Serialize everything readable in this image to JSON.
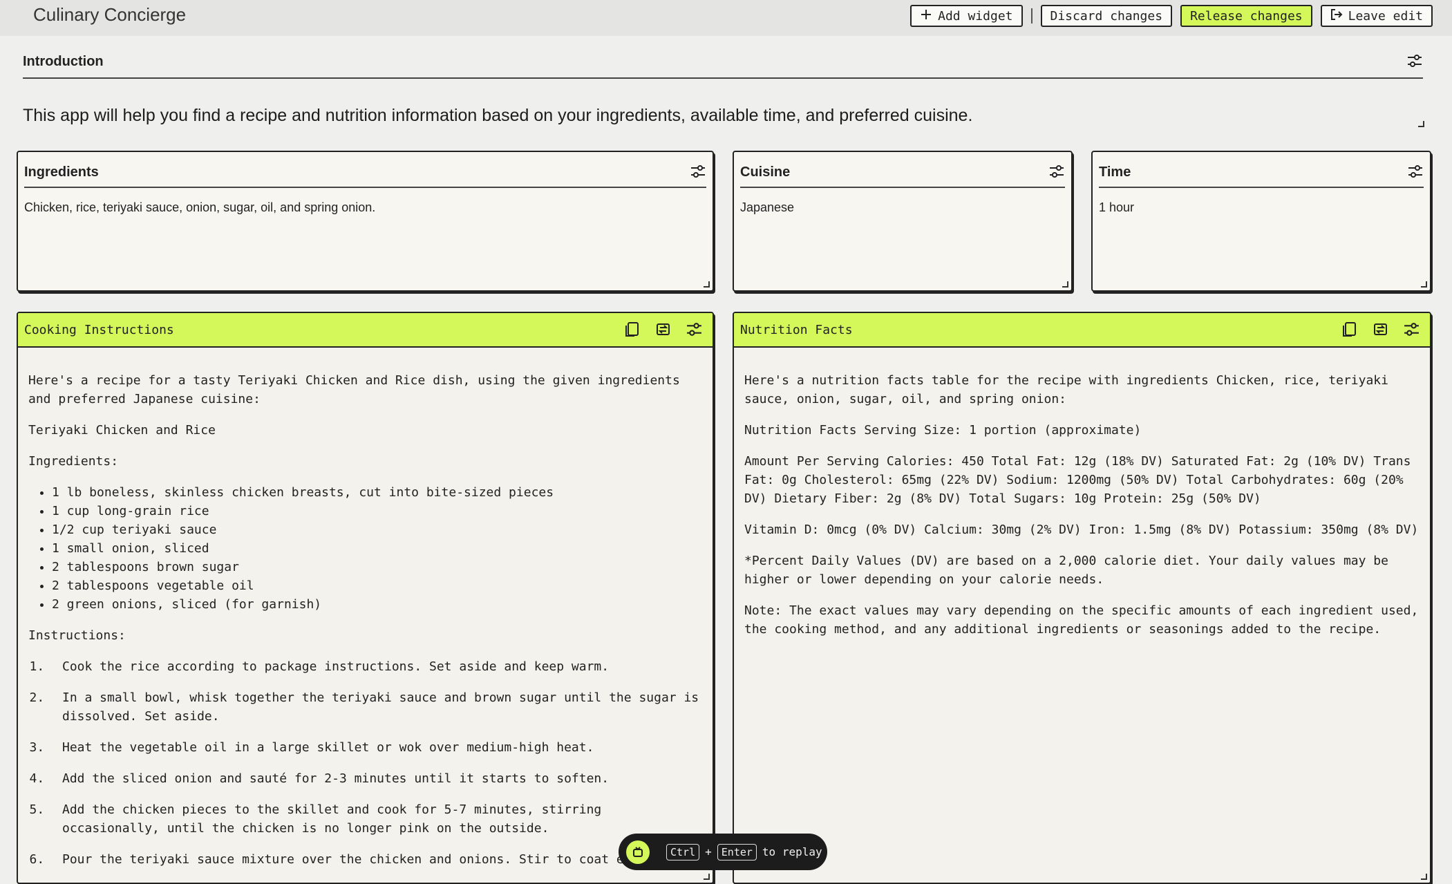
{
  "app": {
    "title": "Culinary Concierge"
  },
  "toolbar": {
    "add_widget": "Add widget",
    "discard": "Discard changes",
    "release": "Release changes",
    "leave": "Leave edit"
  },
  "intro": {
    "label": "Introduction",
    "text": "This app will help you find a recipe and nutrition information based on your ingredients, available time, and preferred cuisine."
  },
  "inputs": {
    "ingredients": {
      "label": "Ingredients",
      "value": "Chicken, rice, teriyaki sauce, onion, sugar, oil, and spring onion."
    },
    "cuisine": {
      "label": "Cuisine",
      "value": "Japanese"
    },
    "time": {
      "label": "Time",
      "value": "1 hour"
    }
  },
  "cooking": {
    "label": "Cooking Instructions",
    "intro": "Here's a recipe for a tasty Teriyaki Chicken and Rice dish, using the given ingredients and preferred Japanese cuisine:",
    "dish": "Teriyaki Chicken and Rice",
    "ingredients_heading": "Ingredients:",
    "ingredients": [
      "1 lb boneless, skinless chicken breasts, cut into bite-sized pieces",
      "1 cup long-grain rice",
      "1/2 cup teriyaki sauce",
      "1 small onion, sliced",
      "2 tablespoons brown sugar",
      "2 tablespoons vegetable oil",
      "2 green onions, sliced (for garnish)"
    ],
    "instructions_heading": "Instructions:",
    "steps": [
      "Cook the rice according to package instructions. Set aside and keep warm.",
      "In a small bowl, whisk together the teriyaki sauce and brown sugar until the sugar is dissolved. Set aside.",
      "Heat the vegetable oil in a large skillet or wok over medium-high heat.",
      "Add the sliced onion and sauté for 2-3 minutes until it starts to soften.",
      "Add the chicken pieces to the skillet and cook for 5-7 minutes, stirring occasionally, until the chicken is no longer pink on the outside.",
      "Pour the teriyaki sauce mixture over the chicken and onions. Stir to coat eve"
    ]
  },
  "nutrition": {
    "label": "Nutrition Facts",
    "paragraphs": [
      "Here's a nutrition facts table for the recipe with ingredients Chicken, rice, teriyaki sauce, onion, sugar, oil, and spring onion:",
      "Nutrition Facts Serving Size: 1 portion (approximate)",
      "Amount Per Serving Calories: 450 Total Fat: 12g (18% DV) Saturated Fat: 2g (10% DV) Trans Fat: 0g Cholesterol: 65mg (22% DV) Sodium: 1200mg (50% DV) Total Carbohydrates: 60g (20% DV) Dietary Fiber: 2g (8% DV) Total Sugars: 10g Protein: 25g (50% DV)",
      "Vitamin D: 0mcg (0% DV) Calcium: 30mg (2% DV) Iron: 1.5mg (8% DV) Potassium: 350mg (8% DV)",
      "*Percent Daily Values (DV) are based on a 2,000 calorie diet. Your daily values may be higher or lower depending on your calorie needs.",
      "Note: The exact values may vary depending on the specific amounts of each ingredient used, the cooking method, and any additional ingredients or seasonings added to the recipe."
    ]
  },
  "replay": {
    "key1": "Ctrl",
    "plus": "+",
    "key2": "Enter",
    "text": "to replay"
  },
  "colors": {
    "accent": "#d4f75a",
    "background": "#efefed",
    "card": "#f7f6f1"
  }
}
